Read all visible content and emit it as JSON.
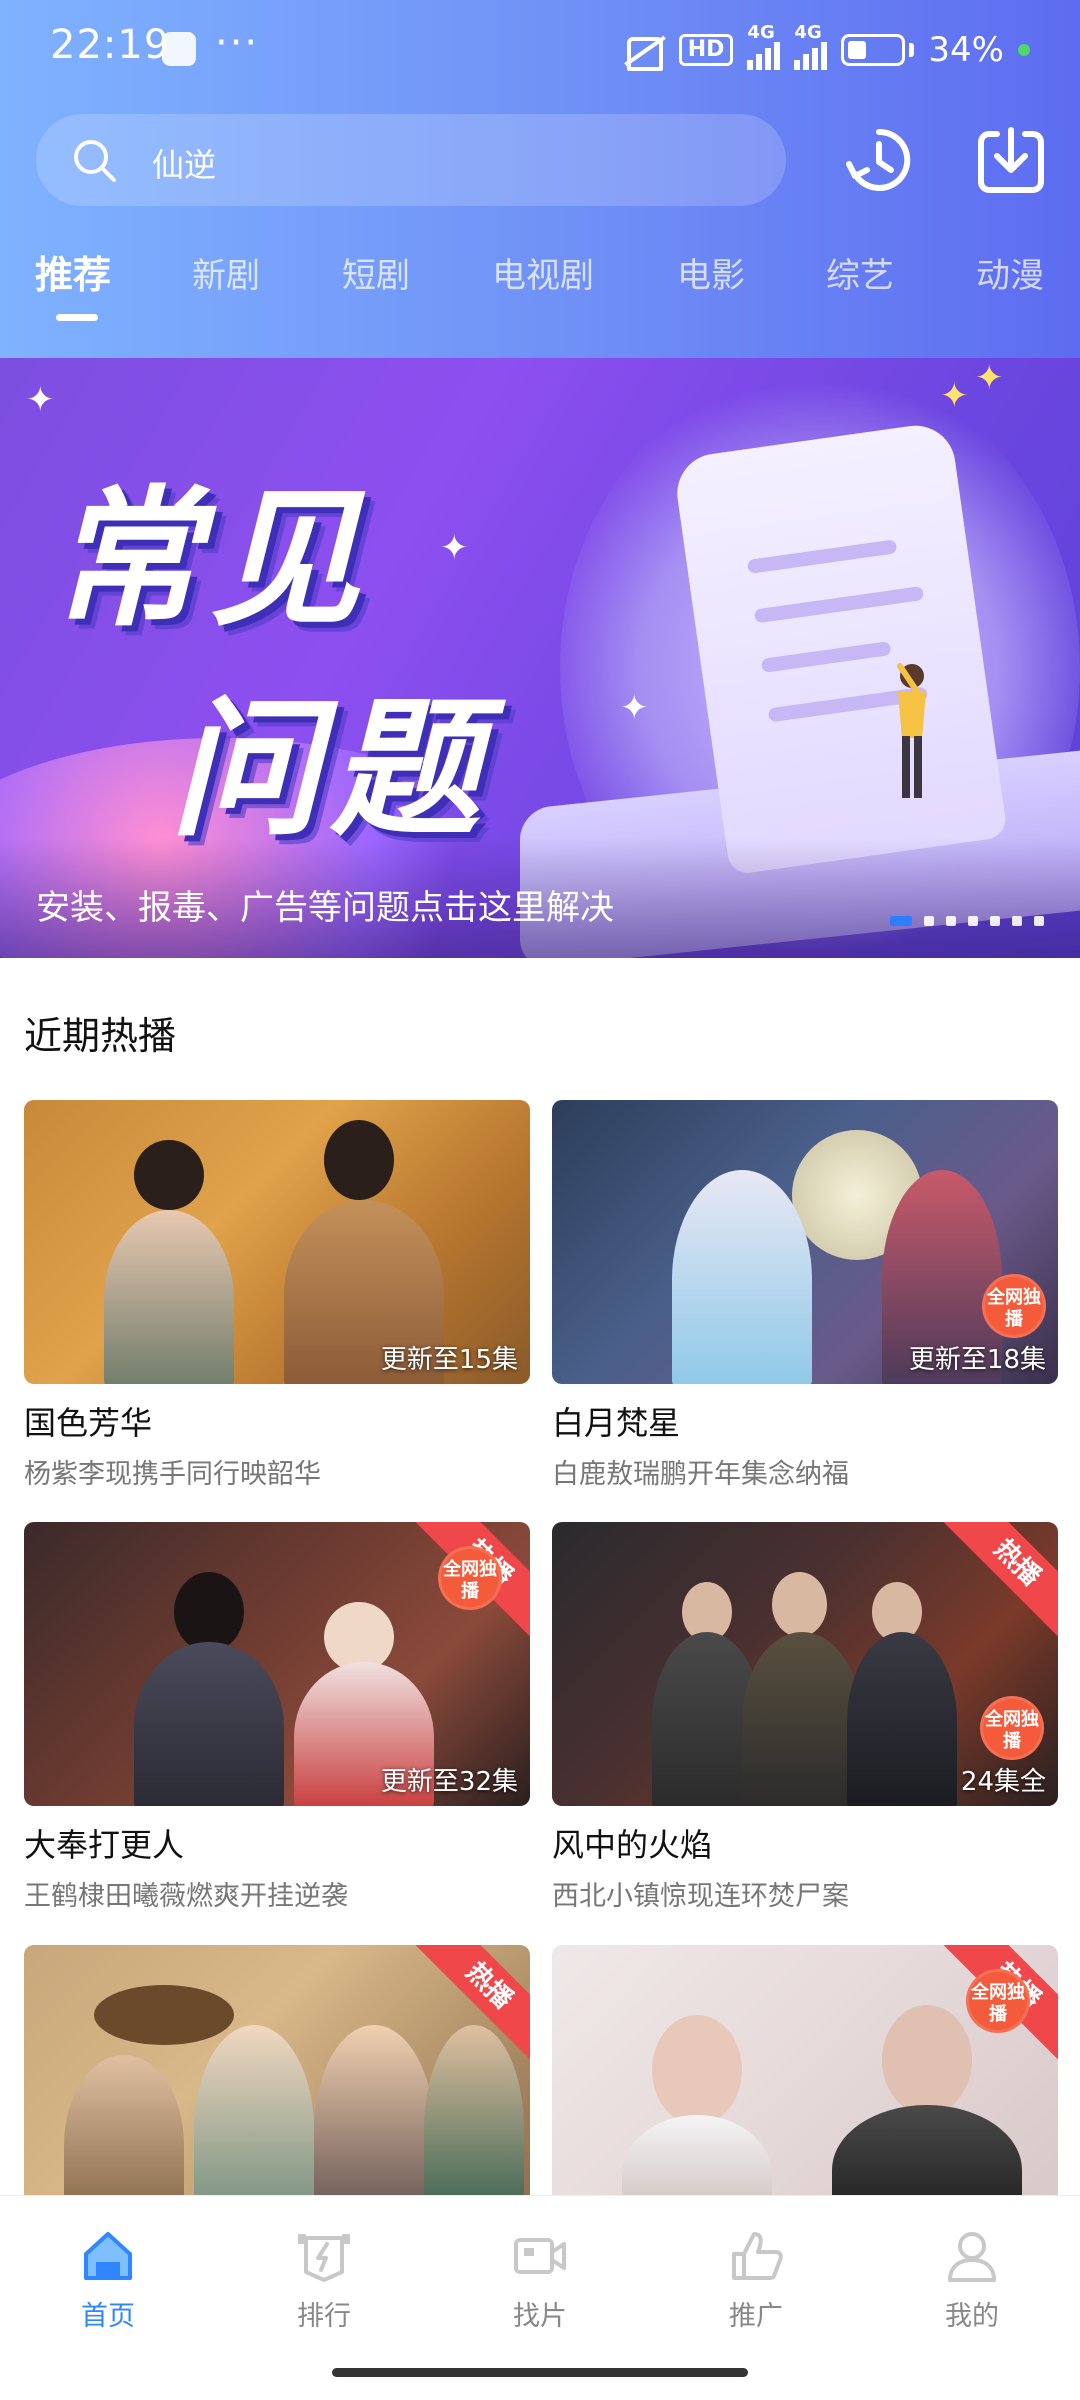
{
  "status_bar": {
    "time": "22:19",
    "dots": "···",
    "hd": "HD",
    "network_1": "4G",
    "network_2": "4G",
    "battery": "34%"
  },
  "search": {
    "text": "仙逆"
  },
  "tabs": [
    {
      "label": "推荐",
      "active": true
    },
    {
      "label": "新剧"
    },
    {
      "label": "短剧"
    },
    {
      "label": "电视剧"
    },
    {
      "label": "电影"
    },
    {
      "label": "综艺"
    },
    {
      "label": "动漫"
    }
  ],
  "banner": {
    "title_line1": "常见",
    "title_line2": "问题",
    "caption": "安装、报毒、广告等问题点击这里解决",
    "page_count": 7,
    "active_page": 1
  },
  "section": {
    "title": "近期热播"
  },
  "cards": [
    {
      "title": "国色芳华",
      "subtitle": "杨紫李现携手同行映韶华",
      "badge": "更新至15集",
      "hot": false
    },
    {
      "title": "白月梵星",
      "subtitle": "白鹿敖瑞鹏开年集念纳福",
      "badge": "更新至18集",
      "hot": false,
      "stamp": "全网独播"
    },
    {
      "title": "大奉打更人",
      "subtitle": "王鹤棣田曦薇燃爽开挂逆袭",
      "badge": "更新至32集",
      "hot": true,
      "hot_label": "热播",
      "stamp": "全网独播"
    },
    {
      "title": "风中的火焰",
      "subtitle": "西北小镇惊现连环焚尸案",
      "badge": "24集全",
      "hot": true,
      "hot_label": "热播",
      "stamp": "全网独播"
    },
    {
      "hot": true,
      "hot_label": "热播"
    },
    {
      "hot": true,
      "hot_label": "热播",
      "stamp": "全网独播"
    }
  ],
  "bottom_nav": [
    {
      "label": "首页",
      "icon": "home-icon",
      "active": true
    },
    {
      "label": "排行",
      "icon": "ranking-icon"
    },
    {
      "label": "找片",
      "icon": "video-icon"
    },
    {
      "label": "推广",
      "icon": "thumb-up-icon"
    },
    {
      "label": "我的",
      "icon": "user-icon"
    }
  ],
  "colors": {
    "accent": "#2f86ff",
    "hot": "#f0484a",
    "header_start": "#7fb2ff",
    "header_end": "#5d6cf0"
  }
}
